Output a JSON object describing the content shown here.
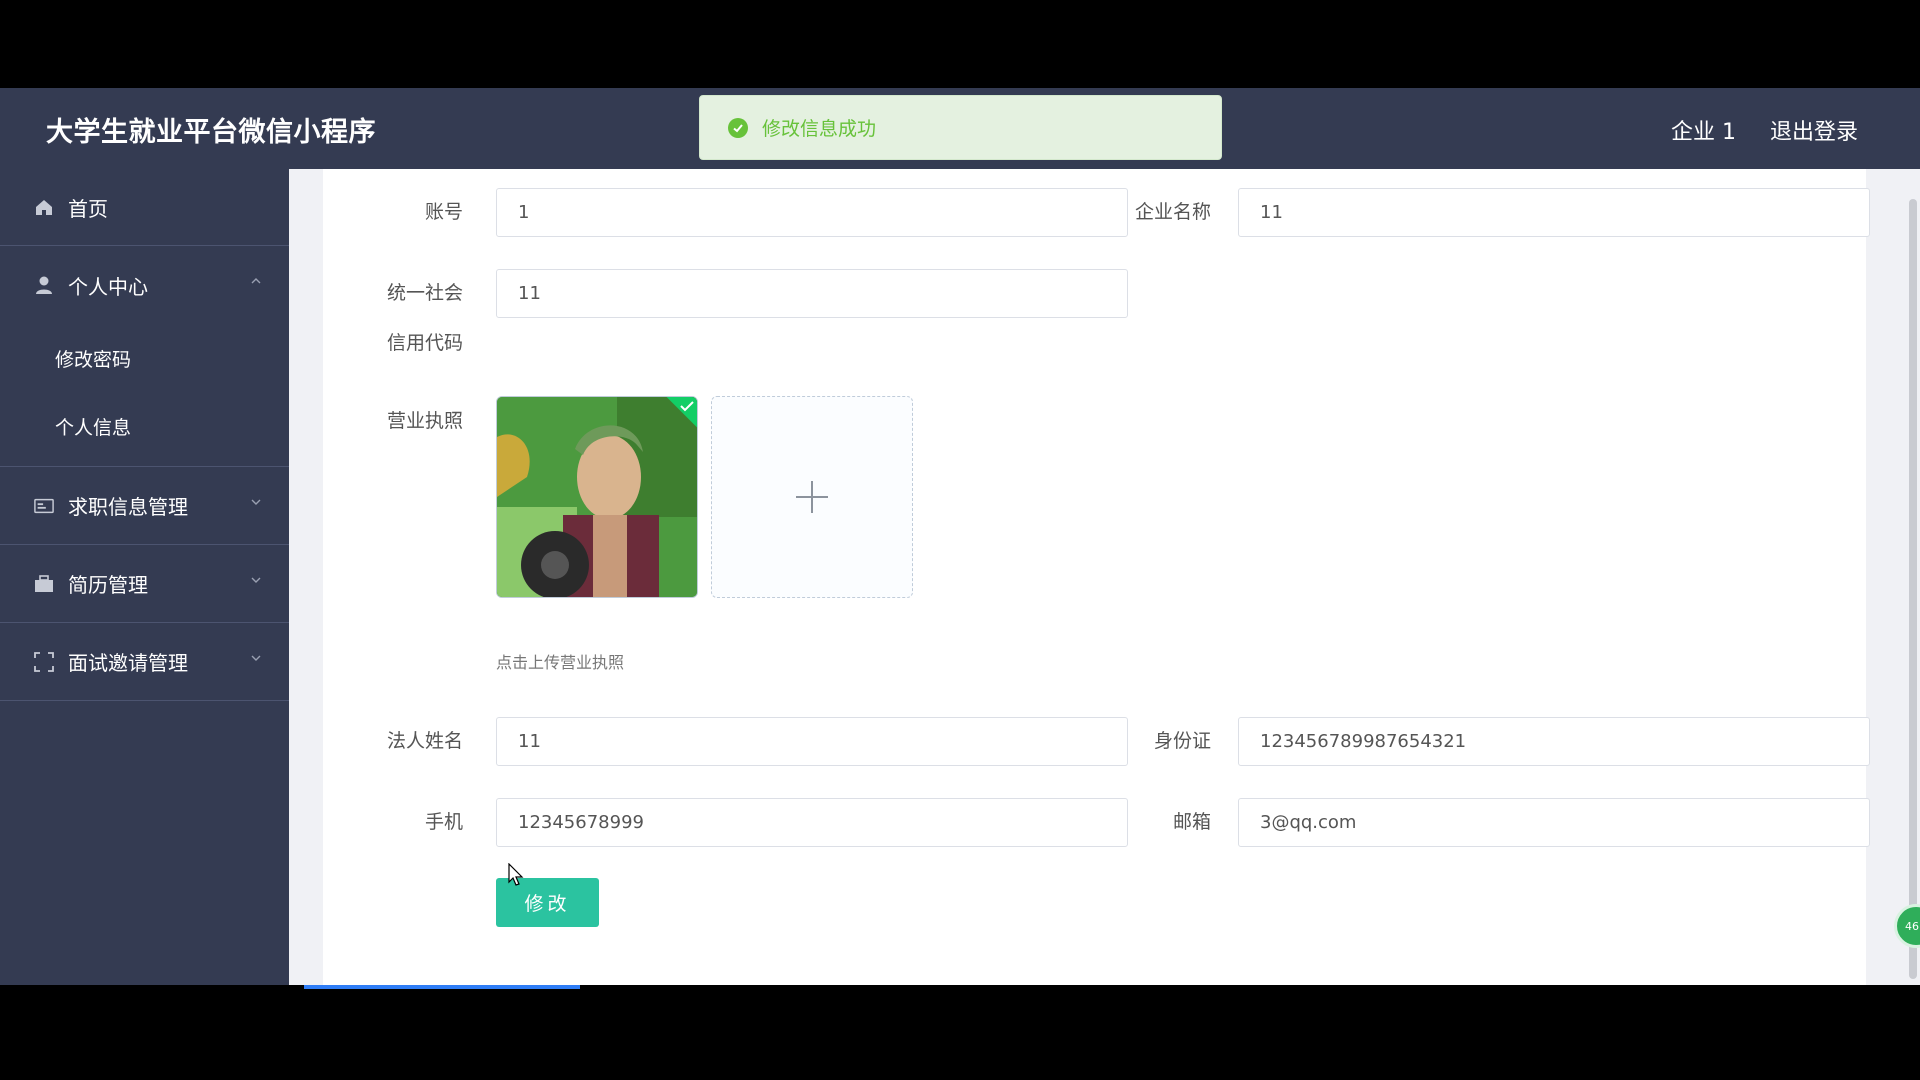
{
  "header": {
    "title": "大学生就业平台微信小程序",
    "user_label": "企业 1",
    "logout_label": "退出登录"
  },
  "toast": {
    "message": "修改信息成功",
    "color": "#67c23a"
  },
  "sidebar": {
    "items": [
      {
        "label": "首页",
        "icon": "home-icon"
      },
      {
        "label": "个人中心",
        "icon": "user-icon",
        "expanded": true,
        "children": [
          {
            "label": "修改密码"
          },
          {
            "label": "个人信息"
          }
        ]
      },
      {
        "label": "求职信息管理",
        "icon": "id-card-icon"
      },
      {
        "label": "简历管理",
        "icon": "briefcase-icon"
      },
      {
        "label": "面试邀请管理",
        "icon": "fullscreen-icon"
      }
    ]
  },
  "form": {
    "account_label": "账号",
    "account_value": "1",
    "company_label": "企业名称",
    "company_value": "11",
    "credit_label_line1": "统一社会",
    "credit_label_line2": "信用代码",
    "credit_value": "11",
    "license_label": "营业执照",
    "license_hint": "点击上传营业执照",
    "legal_label": "法人姓名",
    "legal_value": "11",
    "idcard_label": "身份证",
    "idcard_value": "123456789987654321",
    "phone_label": "手机",
    "phone_value": "12345678999",
    "email_label": "邮箱",
    "email_value": "3@qq.com",
    "submit_label": "修改"
  },
  "badge_text": "46",
  "colors": {
    "sidebar_bg": "#343b52",
    "accent": "#2bc3a0",
    "success": "#67c23a"
  }
}
